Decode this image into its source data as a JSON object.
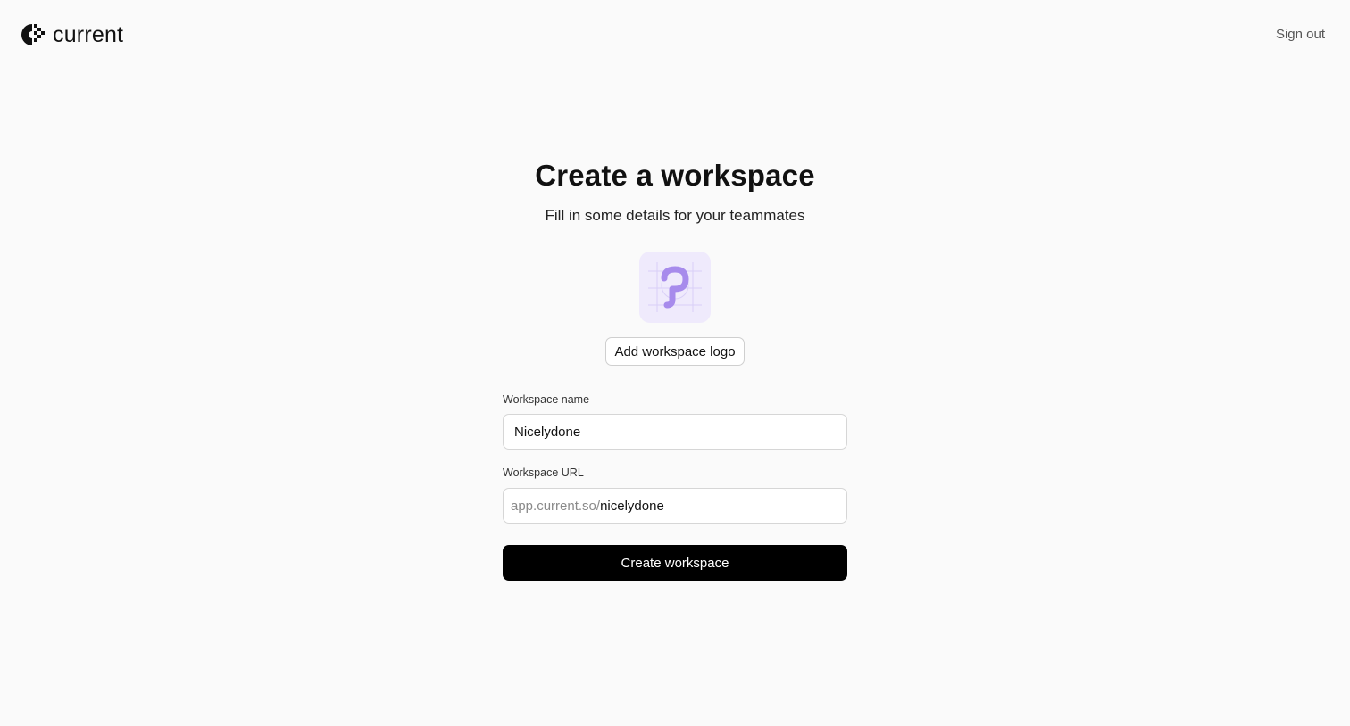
{
  "header": {
    "brand_name": "current",
    "brand_icon": "current-logo-icon",
    "sign_out_label": "Sign out"
  },
  "form": {
    "title": "Create a workspace",
    "subtitle": "Fill in some details for your teammates",
    "logo_icon": "workspace-logo-placeholder-icon",
    "add_logo_label": "Add workspace logo",
    "name_label": "Workspace name",
    "name_value": "Nicelydone",
    "url_label": "Workspace URL",
    "url_prefix": "app.current.so/",
    "url_value": "nicelydone",
    "submit_label": "Create workspace"
  },
  "colors": {
    "background": "#fafafa",
    "logo_tile_bg": "#efeafc",
    "logo_accent": "#a78bec",
    "primary_button": "#000000"
  }
}
